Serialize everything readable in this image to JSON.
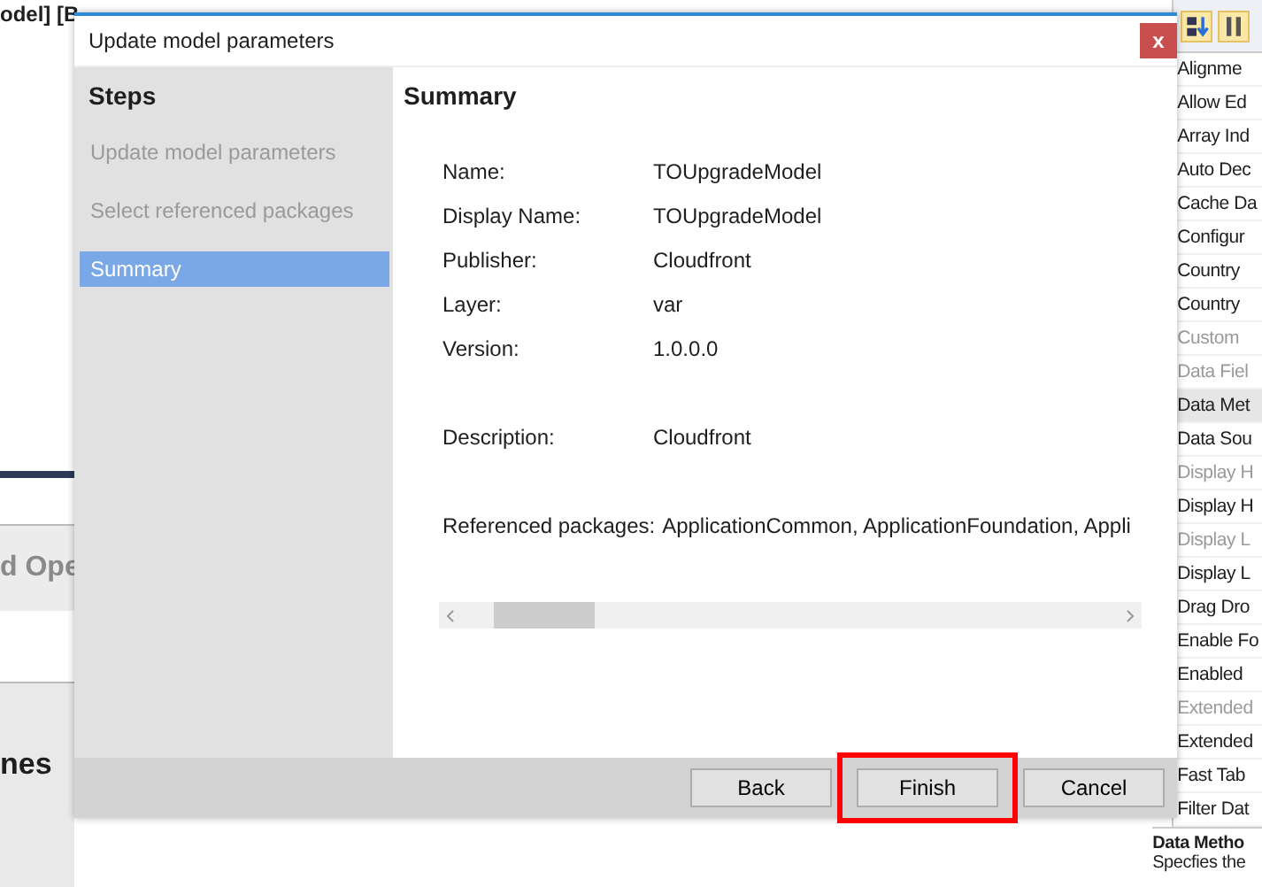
{
  "background": {
    "title_fragment": "odel] [B",
    "side_fragment": "d Ope",
    "heading_fragment": "nes",
    "properties": [
      {
        "label": "Alignme",
        "disabled": false,
        "selected": false
      },
      {
        "label": "Allow Ed",
        "disabled": false,
        "selected": false
      },
      {
        "label": "Array Ind",
        "disabled": false,
        "selected": false
      },
      {
        "label": "Auto Dec",
        "disabled": false,
        "selected": false
      },
      {
        "label": "Cache Da",
        "disabled": false,
        "selected": false
      },
      {
        "label": "Configur",
        "disabled": false,
        "selected": false
      },
      {
        "label": "Country",
        "disabled": false,
        "selected": false
      },
      {
        "label": "Country",
        "disabled": false,
        "selected": false
      },
      {
        "label": "Custom",
        "disabled": true,
        "selected": false
      },
      {
        "label": "Data Fiel",
        "disabled": true,
        "selected": false
      },
      {
        "label": "Data Met",
        "disabled": false,
        "selected": true
      },
      {
        "label": "Data Sou",
        "disabled": false,
        "selected": false
      },
      {
        "label": "Display H",
        "disabled": true,
        "selected": false
      },
      {
        "label": "Display H",
        "disabled": false,
        "selected": false
      },
      {
        "label": "Display L",
        "disabled": true,
        "selected": false
      },
      {
        "label": "Display L",
        "disabled": false,
        "selected": false
      },
      {
        "label": "Drag Dro",
        "disabled": false,
        "selected": false
      },
      {
        "label": "Enable Fo",
        "disabled": false,
        "selected": false
      },
      {
        "label": "Enabled",
        "disabled": false,
        "selected": false
      },
      {
        "label": "Extended",
        "disabled": true,
        "selected": false
      },
      {
        "label": "Extended",
        "disabled": false,
        "selected": false
      },
      {
        "label": "Fast Tab",
        "disabled": false,
        "selected": false
      },
      {
        "label": "Filter Dat",
        "disabled": false,
        "selected": false
      }
    ],
    "description_title": "Data Metho",
    "description_text": "Specfies the"
  },
  "dialog": {
    "title": "Update model parameters",
    "close": "x",
    "steps_heading": "Steps",
    "steps": [
      {
        "label": "Update model parameters",
        "selected": false
      },
      {
        "label": "Select referenced packages",
        "selected": false
      },
      {
        "label": "Summary",
        "selected": true
      }
    ],
    "heading": "Summary",
    "field_groups": [
      [
        {
          "label": "Name:",
          "value": "TOUpgradeModel"
        },
        {
          "label": "Display Name:",
          "value": "TOUpgradeModel"
        },
        {
          "label": "Publisher:",
          "value": "Cloudfront"
        },
        {
          "label": "Layer:",
          "value": "var"
        },
        {
          "label": "Version:",
          "value": "1.0.0.0"
        }
      ],
      [
        {
          "label": "Description:",
          "value": "Cloudfront"
        }
      ],
      [
        {
          "label": "Referenced packages:",
          "value": "ApplicationCommon, ApplicationFoundation, Appli"
        }
      ]
    ],
    "buttons": [
      {
        "label": "Back",
        "highlighted": false
      },
      {
        "label": "Finish",
        "highlighted": true
      },
      {
        "label": "Cancel",
        "highlighted": false
      }
    ]
  }
}
